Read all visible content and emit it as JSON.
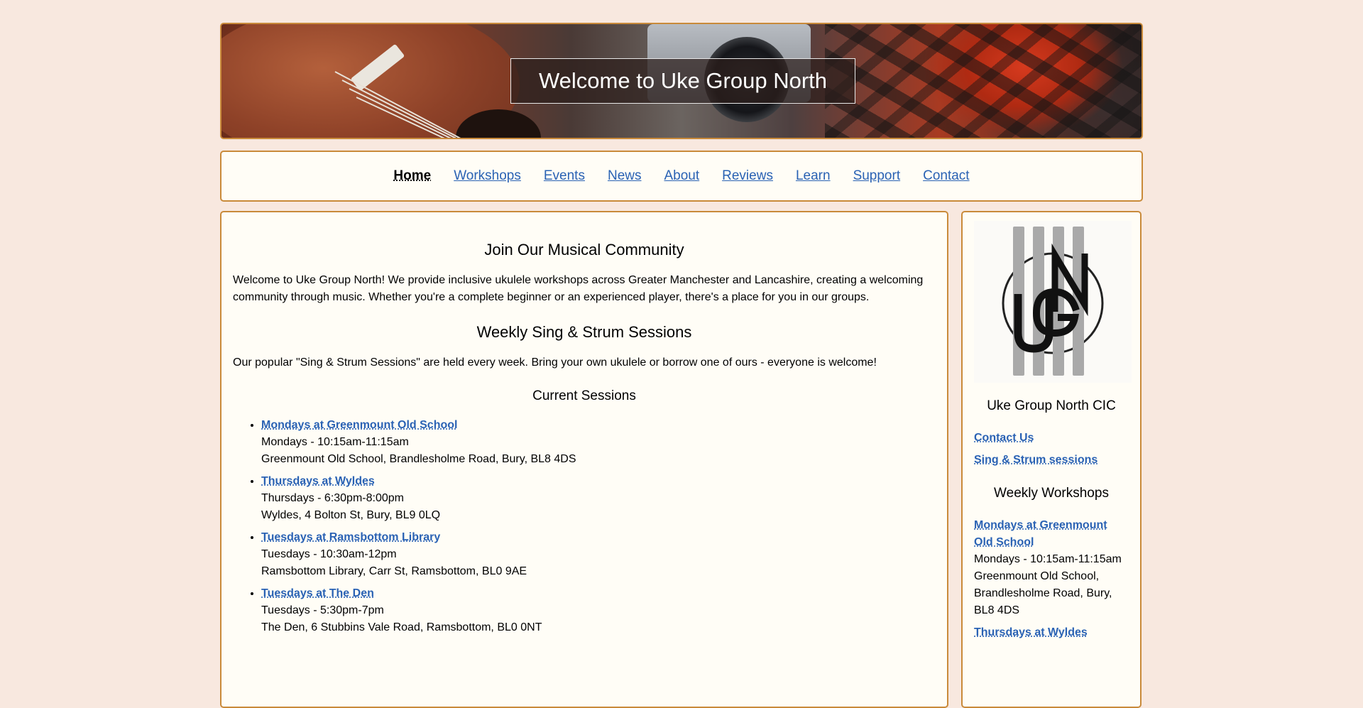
{
  "banner": {
    "title": "Welcome to Uke Group North"
  },
  "nav": {
    "items": [
      {
        "label": "Home",
        "active": true
      },
      {
        "label": "Workshops",
        "active": false
      },
      {
        "label": "Events",
        "active": false
      },
      {
        "label": "News",
        "active": false
      },
      {
        "label": "About",
        "active": false
      },
      {
        "label": "Reviews",
        "active": false
      },
      {
        "label": "Learn",
        "active": false
      },
      {
        "label": "Support",
        "active": false
      },
      {
        "label": "Contact",
        "active": false
      }
    ]
  },
  "main": {
    "heading1": "Join Our Musical Community",
    "intro": "Welcome to Uke Group North! We provide inclusive ukulele workshops across Greater Manchester and Lancashire, creating a welcoming community through music. Whether you're a complete beginner or an experienced player, there's a place for you in our groups.",
    "heading2": "Weekly Sing & Strum Sessions",
    "sessions_intro": "Our popular \"Sing & Strum Sessions\" are held every week. Bring your own ukulele or borrow one of ours - everyone is welcome!",
    "heading3": "Current Sessions",
    "sessions": [
      {
        "name": "Mondays at Greenmount Old School",
        "time": "Mondays - 10:15am-11:15am",
        "address": "Greenmount Old School, Brandlesholme Road, Bury, BL8 4DS"
      },
      {
        "name": "Thursdays at Wyldes",
        "time": "Thursdays - 6:30pm-8:00pm",
        "address": "Wyldes, 4 Bolton St, Bury, BL9 0LQ"
      },
      {
        "name": "Tuesdays at Ramsbottom Library",
        "time": "Tuesdays - 10:30am-12pm",
        "address": "Ramsbottom Library, Carr St, Ramsbottom, BL0 9AE"
      },
      {
        "name": "Tuesdays at The Den",
        "time": "Tuesdays - 5:30pm-7pm",
        "address": "The Den, 6 Stubbins Vale Road, Ramsbottom, BL0 0NT"
      }
    ]
  },
  "sidebar": {
    "logo_icon": "ugn-logo-icon",
    "org_name": "Uke Group North CIC",
    "links": [
      "Contact Us",
      "Sing & Strum sessions"
    ],
    "workshops_heading": "Weekly Workshops",
    "workshops": [
      {
        "name": "Mondays at Greenmount Old School",
        "time": "Mondays - 10:15am-11:15am",
        "address": "Greenmount Old School, Brandlesholme Road, Bury, BL8 4DS"
      },
      {
        "name": "Thursdays at Wyldes"
      }
    ]
  },
  "colors": {
    "page_bg": "#f8e8df",
    "panel_bg": "#fffdf6",
    "border": "#c98a3a",
    "link": "#2a62b4"
  }
}
